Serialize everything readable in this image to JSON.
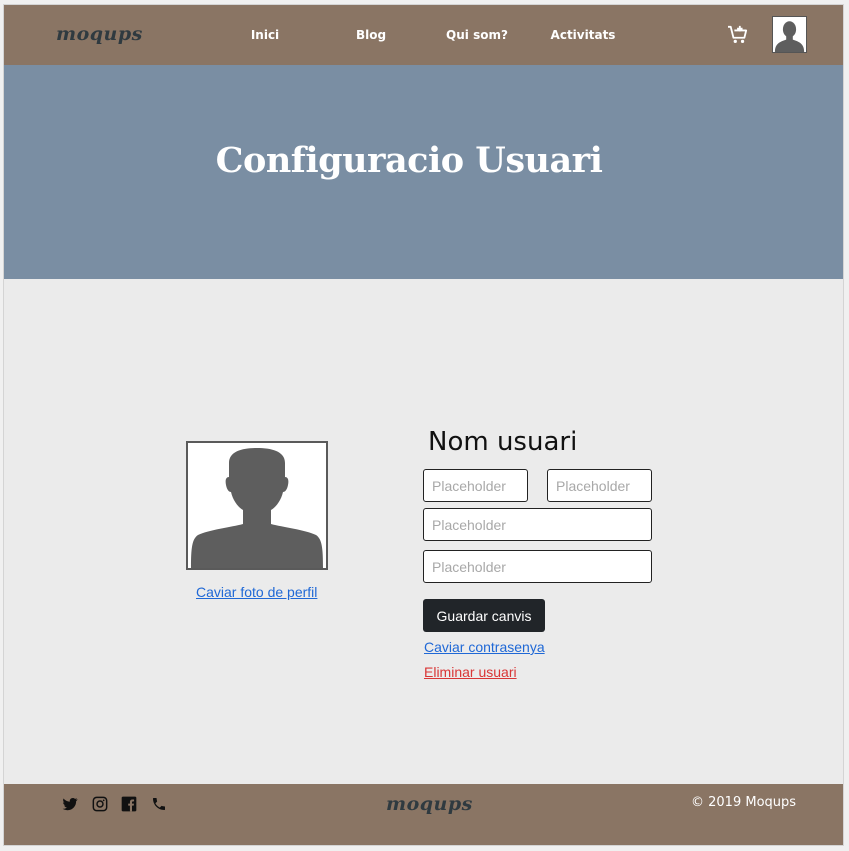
{
  "header": {
    "logo": "moqups",
    "nav": [
      {
        "label": "Inici"
      },
      {
        "label": "Blog"
      },
      {
        "label": "Qui som?"
      },
      {
        "label": "Activitats"
      }
    ],
    "cart_icon": "cart-add-icon",
    "avatar_icon": "user-avatar-icon"
  },
  "hero": {
    "title": "Configuracio Usuari"
  },
  "profile": {
    "photo_icon": "user-silhouette-icon",
    "change_photo_label": "Caviar foto de perfil",
    "username": "Nom usuari",
    "fields": [
      {
        "placeholder": "Placeholder",
        "value": ""
      },
      {
        "placeholder": "Placeholder",
        "value": ""
      },
      {
        "placeholder": "Placeholder",
        "value": ""
      },
      {
        "placeholder": "Placeholder",
        "value": ""
      }
    ],
    "save_label": "Guardar canvis",
    "change_password_label": "Caviar contrasenya",
    "delete_user_label": "Eliminar usuari"
  },
  "footer": {
    "social_icons": [
      "twitter-icon",
      "instagram-icon",
      "facebook-icon",
      "phone-icon"
    ],
    "logo": "moqups",
    "copyright": "© 2019  Moqups"
  },
  "colors": {
    "navbar": "#8a7564",
    "hero": "#7a8ea3",
    "page_bg": "#ebebeb",
    "link_blue": "#1f68d6",
    "link_red": "#d93636",
    "button": "#212529"
  }
}
